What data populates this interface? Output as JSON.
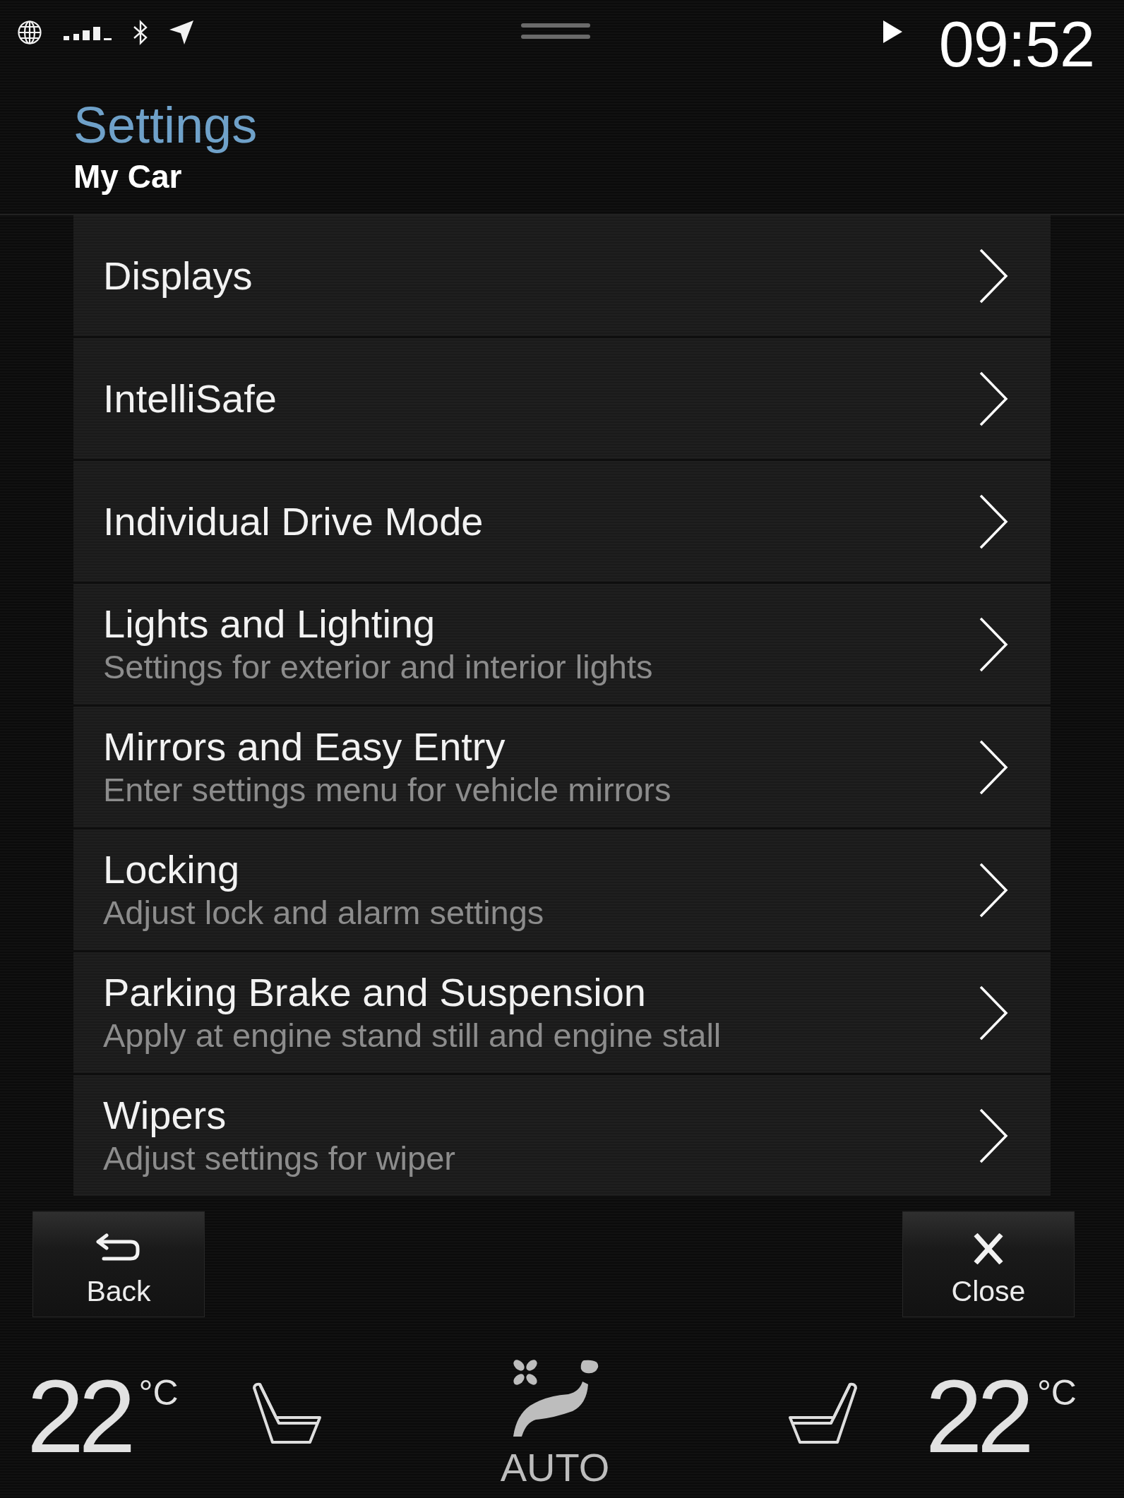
{
  "status_bar": {
    "time": "09:52"
  },
  "header": {
    "title": "Settings",
    "subtitle": "My Car"
  },
  "menu": {
    "items": [
      {
        "title": "Displays"
      },
      {
        "title": "IntelliSafe"
      },
      {
        "title": "Individual Drive Mode"
      },
      {
        "title": "Lights and Lighting",
        "description": "Settings for exterior and interior lights"
      },
      {
        "title": "Mirrors and Easy Entry",
        "description": "Enter settings menu for vehicle mirrors"
      },
      {
        "title": "Locking",
        "description": "Adjust lock and alarm settings"
      },
      {
        "title": "Parking Brake and Suspension",
        "description": "Apply at engine stand still and engine stall"
      },
      {
        "title": "Wipers",
        "description": "Adjust settings for wiper"
      }
    ]
  },
  "buttons": [
    {
      "kind": "back",
      "label": "Back"
    },
    {
      "kind": "close",
      "label": "Close"
    }
  ],
  "climate": {
    "driver": {
      "temperature": "22",
      "unit": "°C"
    },
    "mode": "AUTO",
    "passenger": {
      "temperature": "22",
      "unit": "°C"
    }
  }
}
